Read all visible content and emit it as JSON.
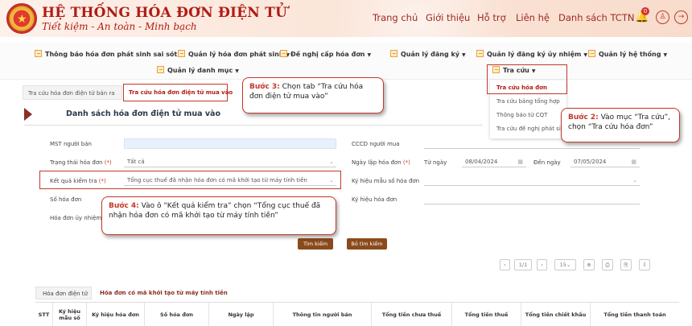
{
  "header": {
    "title": "HỆ THỐNG HÓA ĐƠN ĐIỆN TỬ",
    "slogan": "Tiết kiệm - An toàn - Minh bạch",
    "nav": [
      "Trang chủ",
      "Giới thiệu",
      "Hỗ trợ",
      "Liên hệ",
      "Danh sách TCTN"
    ],
    "notification_count": "0"
  },
  "menu": {
    "row1": [
      "Thông báo hóa đơn phát sinh sai sót",
      "Quản lý hóa đơn phát sinh",
      "Đề nghị cấp hóa đơn",
      "Quản lý đăng ký",
      "Quản lý đăng ký ủy nhiệm",
      "Quản lý hệ thống"
    ],
    "row2": [
      "Quản lý danh mục",
      "Tra cứu"
    ]
  },
  "dropdown": {
    "items": [
      "Tra cứu hóa đơn",
      "Tra cứu bảng tổng hợp",
      "Thông báo từ CQT",
      "Tra cứu đề nghị phát sinh"
    ]
  },
  "tabs": [
    "Tra cứu hóa đơn điện tử bán ra",
    "Tra cứu hóa đơn điện tử mua vào"
  ],
  "page_title": "Danh sách hóa đơn điện tử mua vào",
  "form": {
    "mst_label": "MST người bán",
    "trang_thai_label": "Trạng thái hóa đơn",
    "trang_thai_value": "Tất cả",
    "ket_qua_label": "Kết quả kiểm tra",
    "ket_qua_value": "Tổng cục thuế đã nhận hóa đơn có mã khởi tạo từ máy tính tiền",
    "so_hd_label": "Số hóa đơn",
    "hd_uy_nhiem_label": "Hóa đơn ủy nhiệm",
    "cccd_label": "CCCD người mua",
    "ngay_lap_label": "Ngày lập hóa đơn",
    "tu_ngay_label": "Từ ngày",
    "tu_ngay_value": "08/04/2024",
    "den_ngay_label": "Đến ngày",
    "den_ngay_value": "07/05/2024",
    "ky_hieu_mau_label": "Ký hiệu mẫu số hóa đơn",
    "ky_hieu_hd_label": "Ký hiệu hóa đơn",
    "required_mark": "(*)"
  },
  "buttons": {
    "search": "Tìm kiếm",
    "clear": "Bỏ tìm kiếm"
  },
  "pager": {
    "page": "1/1",
    "size": "15"
  },
  "callouts": {
    "step3_label": "Bước 3:",
    "step3_text": " Chọn tab “Tra cứu hóa đơn điện tử mua vào”",
    "step2_label": "Bước 2:",
    "step2_text": " Vào mục “Tra cứu”, chọn “Tra cứu hóa đơn”",
    "step4_label": "Bước 4:",
    "step4_text": " Vào ô “Kết quả kiểm tra” chọn “Tổng cục thuế đã nhận hóa đơn có mã khởi tạo từ máy tính tiền”"
  },
  "bottom_tabs": [
    "Hóa đơn điện tử",
    "Hóa đơn có mã khởi tạo từ máy tính tiền"
  ],
  "table_headers": [
    "STT",
    "Ký hiệu mẫu số",
    "Ký hiệu hóa đơn",
    "Số hóa đơn",
    "Ngày lập",
    "Thông tin người bán",
    "Tổng tiền chưa thuế",
    "Tổng tiền thuế",
    "Tổng tiền chiết khấu",
    "Tổng tiền thanh toán"
  ],
  "colors": {
    "brand": "#b01c14",
    "accent": "#c0392b",
    "button": "#8b4a1c"
  }
}
